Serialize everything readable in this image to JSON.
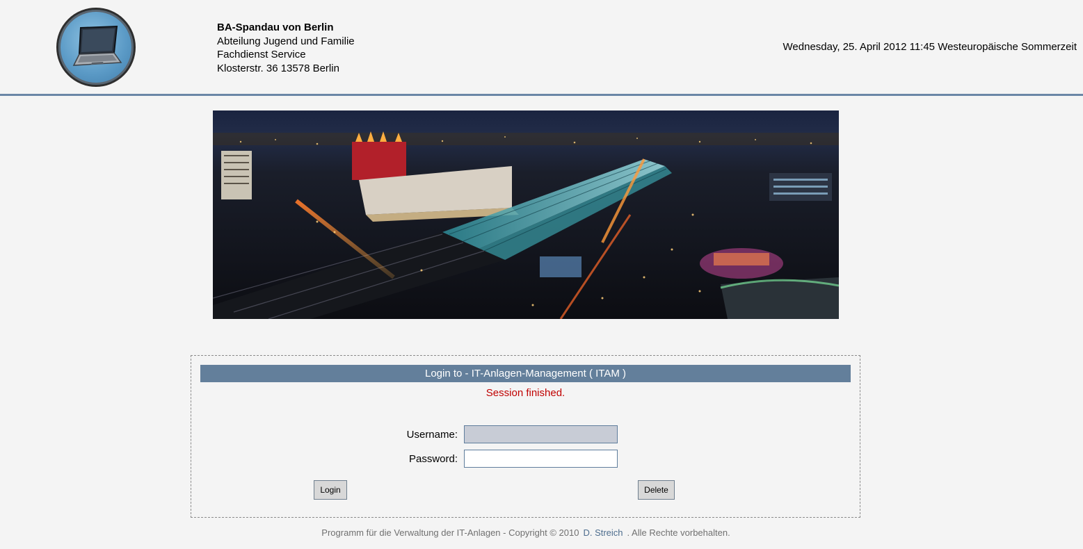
{
  "header": {
    "org_name": "BA-Spandau von Berlin",
    "org_line2": "Abteilung Jugend und Familie",
    "org_line3": "Fachdienst Service",
    "org_line4": "Klosterstr. 36 13578 Berlin",
    "datetime": "Wednesday, 25. April 2012 11:45 Westeuropäische Sommerzeit",
    "logo_icon": "laptop-icon"
  },
  "banner": {
    "description_icon": "city-night-panorama-image"
  },
  "login": {
    "title": "Login to - IT-Anlagen-Management ( ITAM )",
    "session_message": "Session finished.",
    "username_label": "Username:",
    "username_value": "",
    "password_label": "Password:",
    "password_value": "",
    "login_button": "Login",
    "delete_button": "Delete"
  },
  "footer": {
    "text_before": "Programm für die Verwaltung der IT-Anlagen - Copyright © 2010",
    "author_link": "D. Streich",
    "text_after": ". Alle Rechte vorbehalten."
  },
  "colors": {
    "accent": "#637f9b",
    "header_rule": "#6a86a6",
    "error": "#c00000",
    "background": "#f4f4f4"
  }
}
